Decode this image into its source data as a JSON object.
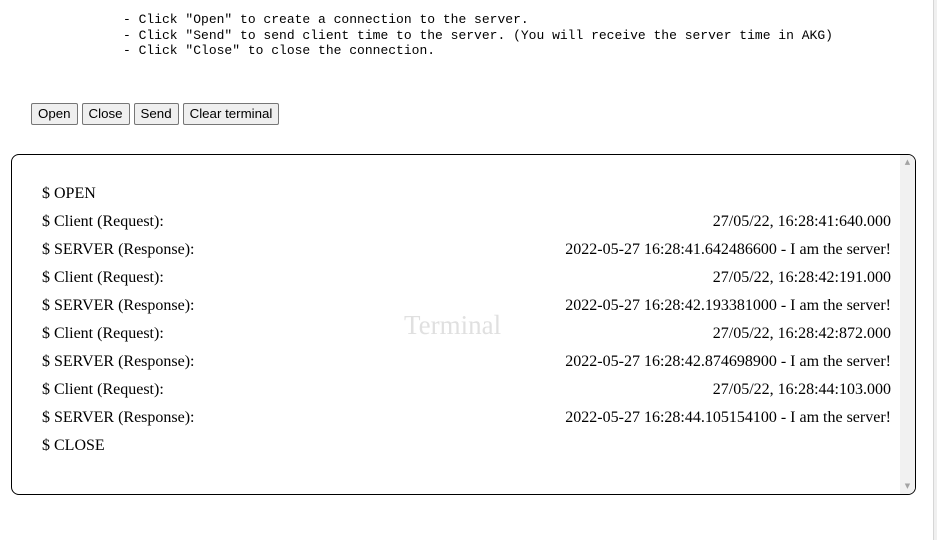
{
  "instructions": [
    "- Click \"Open\" to create a connection to the server.",
    "- Click \"Send\" to send client time to the server. (You will receive the server time in AKG)",
    "- Click \"Close\" to close the connection."
  ],
  "buttons": {
    "open": "Open",
    "close": "Close",
    "send": "Send",
    "clear": "Clear terminal"
  },
  "terminal": {
    "watermark": "Terminal",
    "lines": [
      {
        "label": "$ OPEN",
        "value": ""
      },
      {
        "label": "$ Client (Request):",
        "value": "27/05/22, 16:28:41:640.000"
      },
      {
        "label": "$ SERVER (Response):",
        "value": "2022-05-27 16:28:41.642486600 - I am the server!"
      },
      {
        "label": "$ Client (Request):",
        "value": "27/05/22, 16:28:42:191.000"
      },
      {
        "label": "$ SERVER (Response):",
        "value": "2022-05-27 16:28:42.193381000 - I am the server!"
      },
      {
        "label": "$ Client (Request):",
        "value": "27/05/22, 16:28:42:872.000"
      },
      {
        "label": "$ SERVER (Response):",
        "value": "2022-05-27 16:28:42.874698900 - I am the server!"
      },
      {
        "label": "$ Client (Request):",
        "value": "27/05/22, 16:28:44:103.000"
      },
      {
        "label": "$ SERVER (Response):",
        "value": "2022-05-27 16:28:44.105154100 - I am the server!"
      },
      {
        "label": "$ CLOSE",
        "value": ""
      }
    ],
    "scroll_up_icon": "▲",
    "scroll_down_icon": "▼"
  }
}
